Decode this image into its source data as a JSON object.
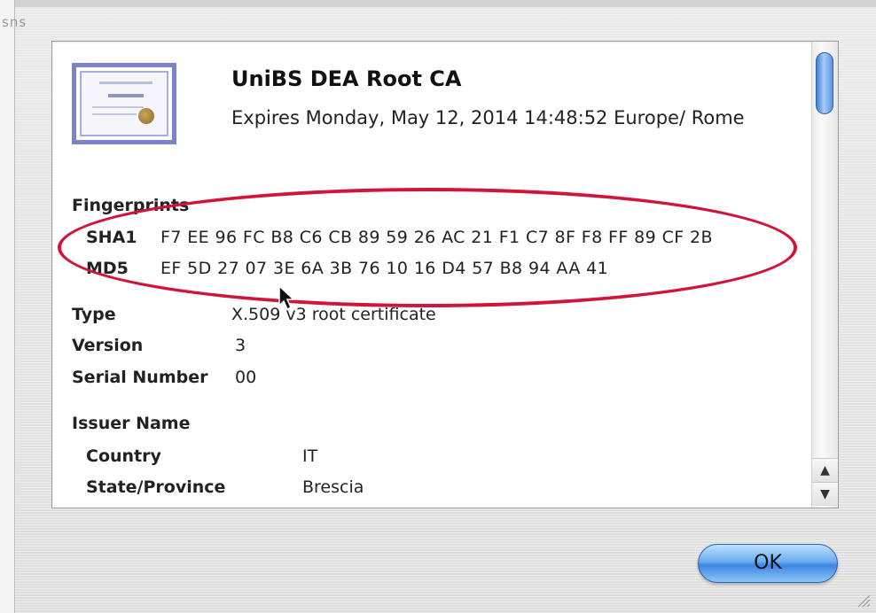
{
  "window": {
    "left_edge_text": "sns"
  },
  "certificate": {
    "name": "UniBS DEA Root CA",
    "expires": "Expires Monday, May 12, 2014 14:48:52 Europe/ Rome"
  },
  "fingerprints": {
    "heading": "Fingerprints",
    "sha1": {
      "label": "SHA1",
      "value": "F7 EE 96 FC B8 C6 CB 89 59 26 AC 21 F1 C7 8F F8 FF 89 CF 2B"
    },
    "md5": {
      "label": "MD5",
      "value": "EF 5D 27 07 3E 6A 3B 76 10 16 D4 57 B8 94 AA 41"
    }
  },
  "details": {
    "type": {
      "label": "Type",
      "value": "X.509 v3 root certificate"
    },
    "version": {
      "label": "Version",
      "value": "3"
    },
    "serial": {
      "label": "Serial Number",
      "value": "00"
    }
  },
  "issuer": {
    "heading": "Issuer Name",
    "country": {
      "label": "Country",
      "value": "IT"
    },
    "state": {
      "label": "State/Province",
      "value": "Brescia"
    }
  },
  "buttons": {
    "ok": "OK"
  },
  "colors": {
    "highlight": "#d0143a",
    "ok_button": "#3c86e3",
    "scroll_thumb": "#3d7fd6"
  },
  "icons": [
    "certificate-icon",
    "cursor-icon",
    "scroll-up-arrow-icon",
    "scroll-down-arrow-icon",
    "resize-grip-icon"
  ]
}
